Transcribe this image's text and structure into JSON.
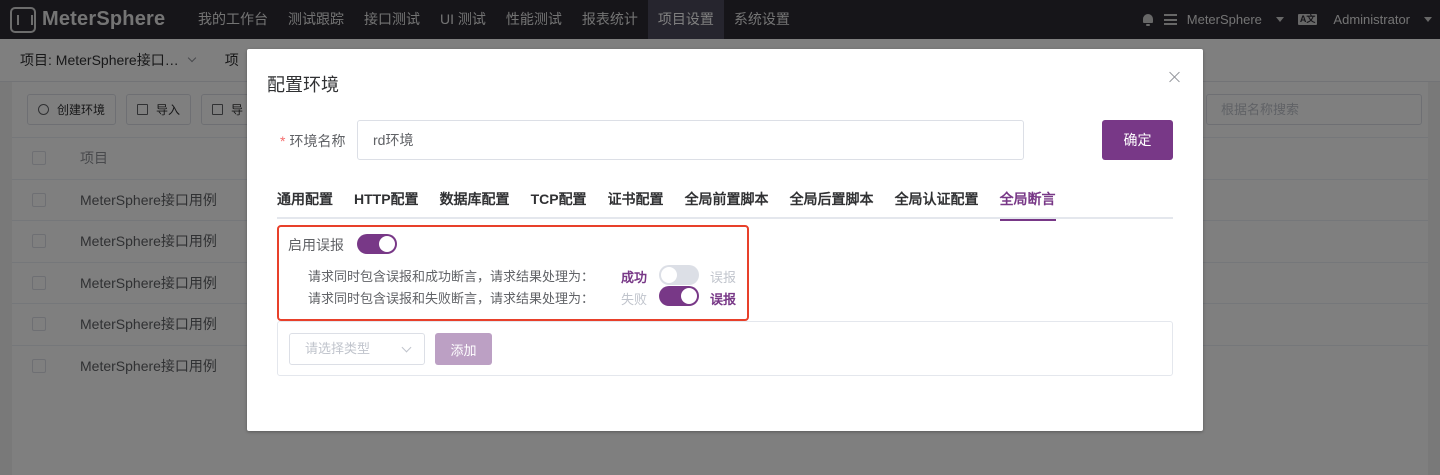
{
  "nav": {
    "brand": "MeterSphere",
    "menu": [
      "我的工作台",
      "测试跟踪",
      "接口测试",
      "UI 测试",
      "性能测试",
      "报表统计",
      "项目设置",
      "系统设置"
    ],
    "active_menu": "项目设置",
    "workspace": "MeterSphere",
    "lang_icon": "A文",
    "user": "Administrator",
    "icons": [
      "bell-icon",
      "task-list-icon",
      "language-icon"
    ]
  },
  "page": {
    "project_select": "项目: MeterSphere接口…",
    "second_crumb": "项",
    "toolbar": {
      "create_env": "创建环境",
      "import": "导入",
      "export_partial": "导"
    },
    "search_placeholder": "根据名称搜索",
    "table": {
      "header": "项目",
      "rows": [
        "MeterSphere接口用例",
        "MeterSphere接口用例",
        "MeterSphere接口用例",
        "MeterSphere接口用例",
        "MeterSphere接口用例"
      ]
    }
  },
  "dialog": {
    "title": "配置环境",
    "env_name_label": "环境名称",
    "env_name_value": "rd环境",
    "confirm": "确定",
    "tabs": [
      "通用配置",
      "HTTP配置",
      "数据库配置",
      "TCP配置",
      "证书配置",
      "全局前置脚本",
      "全局后置脚本",
      "全局认证配置",
      "全局断言"
    ],
    "active_tab": "全局断言",
    "false_alarm": {
      "enable_label": "启用误报",
      "enabled": true,
      "rule_success": {
        "text": "请求同时包含误报和成功断言，请求结果处理为：",
        "left": "成功",
        "right": "误报",
        "selected": "成功"
      },
      "rule_fail": {
        "text": "请求同时包含误报和失败断言，请求结果处理为：",
        "left": "失败",
        "right": "误报",
        "selected": "误报"
      }
    },
    "assert": {
      "type_placeholder": "请选择类型",
      "add": "添加"
    }
  },
  "colors": {
    "primary": "#783887",
    "nav_bg": "#2c2a33",
    "highlight_border": "#e8402a"
  }
}
